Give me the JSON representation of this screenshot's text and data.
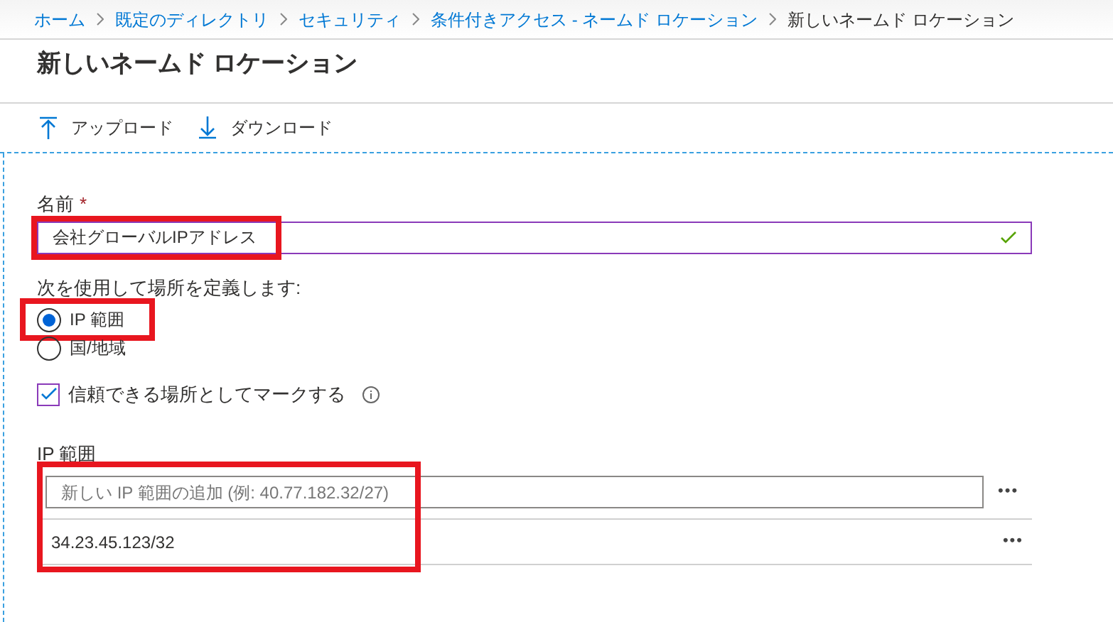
{
  "breadcrumb": [
    {
      "label": "ホーム",
      "link": true
    },
    {
      "label": "既定のディレクトリ",
      "link": true
    },
    {
      "label": "セキュリティ",
      "link": true
    },
    {
      "label": "条件付きアクセス - ネームド ロケーション",
      "link": true
    },
    {
      "label": "新しいネームド ロケーション",
      "link": false
    }
  ],
  "title": "新しいネームド ロケーション",
  "toolbar": [
    {
      "label": "アップロード",
      "kind": "upload"
    },
    {
      "label": "ダウンロード",
      "kind": "download"
    }
  ],
  "name_field": {
    "label": "名前",
    "required_mark": "*",
    "value": "会社グローバルIPアドレス",
    "valid": true,
    "highlighted": true
  },
  "define_by": {
    "label": "次を使用して場所を定義します:",
    "options": [
      {
        "label": "IP 範囲",
        "selected": true,
        "highlighted": true
      },
      {
        "label": "国/地域",
        "selected": false,
        "highlighted": false
      }
    ]
  },
  "trusted": {
    "label": "信頼できる場所としてマークする",
    "checked": true
  },
  "ip_ranges": {
    "label": "IP 範囲",
    "highlighted": true,
    "input": {
      "placeholder": "新しい IP 範囲の追加 (例: 40.77.182.32/27)",
      "menu": "•••"
    },
    "rows": [
      {
        "value": "34.23.45.123/32",
        "menu": "•••"
      }
    ]
  }
}
